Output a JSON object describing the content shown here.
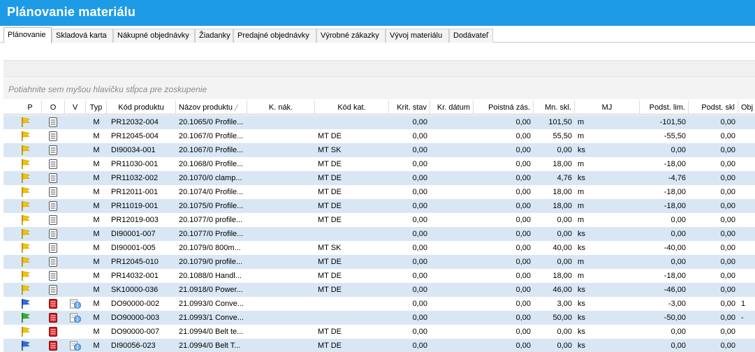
{
  "window": {
    "title": "Plánovanie materiálu"
  },
  "tabs": [
    {
      "label": "Plánovanie",
      "active": true
    },
    {
      "label": "Skladová karta"
    },
    {
      "label": "Nákupné objednávky"
    },
    {
      "label": "Žiadanky"
    },
    {
      "label": "Predajné objednávky"
    },
    {
      "label": "Výrobné zákazky"
    },
    {
      "label": "Vývoj materiálu"
    },
    {
      "label": "Dodávateľ"
    }
  ],
  "group_hint": "Potiahnite sem myšou hlavičku stĺpca pre zoskupenie",
  "columns": [
    {
      "key": "p",
      "label": "P"
    },
    {
      "key": "o",
      "label": "O"
    },
    {
      "key": "v",
      "label": "V"
    },
    {
      "key": "typ",
      "label": "Typ"
    },
    {
      "key": "kod",
      "label": "Kód produktu"
    },
    {
      "key": "nazov",
      "label": "Názov produktu",
      "sorted": true
    },
    {
      "key": "knak",
      "label": "K. nák."
    },
    {
      "key": "kodkat",
      "label": "Kód kat."
    },
    {
      "key": "krit",
      "label": "Krit. stav"
    },
    {
      "key": "krdat",
      "label": "Kr. dátum"
    },
    {
      "key": "poist",
      "label": "Poistná zás."
    },
    {
      "key": "mnskl",
      "label": "Mn. skl."
    },
    {
      "key": "mj",
      "label": "MJ"
    },
    {
      "key": "podlim",
      "label": "Podst. lim."
    },
    {
      "key": "podskl",
      "label": "Podst. skl"
    },
    {
      "key": "obj",
      "label": "Obj"
    }
  ],
  "icon_names": {
    "yellow": "yellow-flag-icon",
    "blue": "blue-flag-icon",
    "green": "green-flag-icon",
    "doc": "document-icon",
    "red": "red-document-icon",
    "globe": "globe-icon"
  },
  "colors": {
    "title_bar": "#1e9be6",
    "row_alt": "#d9e7f5",
    "flag_yellow": "#f5c400",
    "flag_blue": "#2f6fe0",
    "flag_green": "#2fb52f",
    "doc_red": "#d42020"
  },
  "rows": [
    {
      "flag": "yellow",
      "o": "doc",
      "v": "",
      "typ": "M",
      "kod": "PR12032-004",
      "nazov": "20.1065/0  Profile...",
      "knak": "",
      "kodkat": "",
      "krit": "0,00",
      "krdat": "",
      "poist": "0,00",
      "mnskl": "101,50",
      "mj": "m",
      "podlim": "-101,50",
      "podskl": "0,00",
      "obj": ""
    },
    {
      "flag": "yellow",
      "o": "doc",
      "v": "",
      "typ": "M",
      "kod": "PR12045-004",
      "nazov": "20.1067/0  Profile...",
      "knak": "",
      "kodkat": "MT DE",
      "krit": "0,00",
      "krdat": "",
      "poist": "0,00",
      "mnskl": "55,50",
      "mj": "m",
      "podlim": "-55,50",
      "podskl": "0,00",
      "obj": ""
    },
    {
      "flag": "yellow",
      "o": "doc",
      "v": "",
      "typ": "M",
      "kod": "DI90034-001",
      "nazov": "20.1067/0  Profile...",
      "knak": "",
      "kodkat": "MT SK",
      "krit": "0,00",
      "krdat": "",
      "poist": "0,00",
      "mnskl": "0,00",
      "mj": "ks",
      "podlim": "0,00",
      "podskl": "0,00",
      "obj": ""
    },
    {
      "flag": "yellow",
      "o": "doc",
      "v": "",
      "typ": "M",
      "kod": "PR11030-001",
      "nazov": "20.1068/0  Profile...",
      "knak": "",
      "kodkat": "MT DE",
      "krit": "0,00",
      "krdat": "",
      "poist": "0,00",
      "mnskl": "18,00",
      "mj": "m",
      "podlim": "-18,00",
      "podskl": "0,00",
      "obj": ""
    },
    {
      "flag": "yellow",
      "o": "doc",
      "v": "",
      "typ": "M",
      "kod": "PR11032-002",
      "nazov": "20.1070/0  clamp...",
      "knak": "",
      "kodkat": "MT DE",
      "krit": "0,00",
      "krdat": "",
      "poist": "0,00",
      "mnskl": "4,76",
      "mj": "ks",
      "podlim": "-4,76",
      "podskl": "0,00",
      "obj": ""
    },
    {
      "flag": "yellow",
      "o": "doc",
      "v": "",
      "typ": "M",
      "kod": "PR12011-001",
      "nazov": "20.1074/0  Profile...",
      "knak": "",
      "kodkat": "MT DE",
      "krit": "0,00",
      "krdat": "",
      "poist": "0,00",
      "mnskl": "18,00",
      "mj": "m",
      "podlim": "-18,00",
      "podskl": "0,00",
      "obj": ""
    },
    {
      "flag": "yellow",
      "o": "doc",
      "v": "",
      "typ": "M",
      "kod": "PR11019-001",
      "nazov": "20.1075/0  Profile...",
      "knak": "",
      "kodkat": "MT DE",
      "krit": "0,00",
      "krdat": "",
      "poist": "0,00",
      "mnskl": "18,00",
      "mj": "m",
      "podlim": "-18,00",
      "podskl": "0,00",
      "obj": ""
    },
    {
      "flag": "yellow",
      "o": "doc",
      "v": "",
      "typ": "M",
      "kod": "PR12019-003",
      "nazov": "20.1077/0  profile...",
      "knak": "",
      "kodkat": "MT DE",
      "krit": "0,00",
      "krdat": "",
      "poist": "0,00",
      "mnskl": "0,00",
      "mj": "m",
      "podlim": "0,00",
      "podskl": "0,00",
      "obj": ""
    },
    {
      "flag": "yellow",
      "o": "doc",
      "v": "",
      "typ": "M",
      "kod": "DI90001-007",
      "nazov": "20.1077/0  Profile...",
      "knak": "",
      "kodkat": "",
      "krit": "0,00",
      "krdat": "",
      "poist": "0,00",
      "mnskl": "0,00",
      "mj": "ks",
      "podlim": "0,00",
      "podskl": "0,00",
      "obj": ""
    },
    {
      "flag": "yellow",
      "o": "doc",
      "v": "",
      "typ": "M",
      "kod": "DI90001-005",
      "nazov": "20.1079/0  800m...",
      "knak": "",
      "kodkat": "MT SK",
      "krit": "0,00",
      "krdat": "",
      "poist": "0,00",
      "mnskl": "40,00",
      "mj": "ks",
      "podlim": "-40,00",
      "podskl": "0,00",
      "obj": ""
    },
    {
      "flag": "yellow",
      "o": "doc",
      "v": "",
      "typ": "M",
      "kod": "PR12045-010",
      "nazov": "20.1079/0  profile...",
      "knak": "",
      "kodkat": "MT DE",
      "krit": "0,00",
      "krdat": "",
      "poist": "0,00",
      "mnskl": "0,00",
      "mj": "m",
      "podlim": "0,00",
      "podskl": "0,00",
      "obj": ""
    },
    {
      "flag": "yellow",
      "o": "doc",
      "v": "",
      "typ": "M",
      "kod": "PR14032-001",
      "nazov": "20.1088/0  Handl...",
      "knak": "",
      "kodkat": "MT DE",
      "krit": "0,00",
      "krdat": "",
      "poist": "0,00",
      "mnskl": "18,00",
      "mj": "m",
      "podlim": "-18,00",
      "podskl": "0,00",
      "obj": ""
    },
    {
      "flag": "yellow",
      "o": "doc",
      "v": "",
      "typ": "M",
      "kod": "SK10000-036",
      "nazov": "21.0918/0  Power...",
      "knak": "",
      "kodkat": "MT DE",
      "krit": "0,00",
      "krdat": "",
      "poist": "0,00",
      "mnskl": "46,00",
      "mj": "ks",
      "podlim": "-46,00",
      "podskl": "0,00",
      "obj": ""
    },
    {
      "flag": "blue",
      "o": "red",
      "v": "globe",
      "typ": "M",
      "kod": "DO90000-002",
      "nazov": "21.0993/0  Conve...",
      "knak": "",
      "kodkat": "",
      "krit": "0,00",
      "krdat": "",
      "poist": "0,00",
      "mnskl": "3,00",
      "mj": "ks",
      "podlim": "-3,00",
      "podskl": "0,00",
      "obj": "1"
    },
    {
      "flag": "green",
      "o": "red",
      "v": "globe",
      "typ": "M",
      "kod": "DO90000-003",
      "nazov": "21.0993/1  Conve...",
      "knak": "",
      "kodkat": "",
      "krit": "0,00",
      "krdat": "",
      "poist": "0,00",
      "mnskl": "50,00",
      "mj": "ks",
      "podlim": "-50,00",
      "podskl": "0,00",
      "obj": "-"
    },
    {
      "flag": "yellow",
      "o": "red",
      "v": "",
      "typ": "M",
      "kod": "DO90000-007",
      "nazov": "21.0994/0  Belt te...",
      "knak": "",
      "kodkat": "MT DE",
      "krit": "0,00",
      "krdat": "",
      "poist": "0,00",
      "mnskl": "0,00",
      "mj": "ks",
      "podlim": "0,00",
      "podskl": "0,00",
      "obj": ""
    },
    {
      "flag": "blue",
      "o": "red",
      "v": "globe",
      "typ": "M",
      "kod": "DI90056-023",
      "nazov": "21.0994/0  Belt T...",
      "knak": "",
      "kodkat": "MT DE",
      "krit": "0,00",
      "krdat": "",
      "poist": "0,00",
      "mnskl": "0,00",
      "mj": "ks",
      "podlim": "0,00",
      "podskl": "0,00",
      "obj": ""
    }
  ]
}
